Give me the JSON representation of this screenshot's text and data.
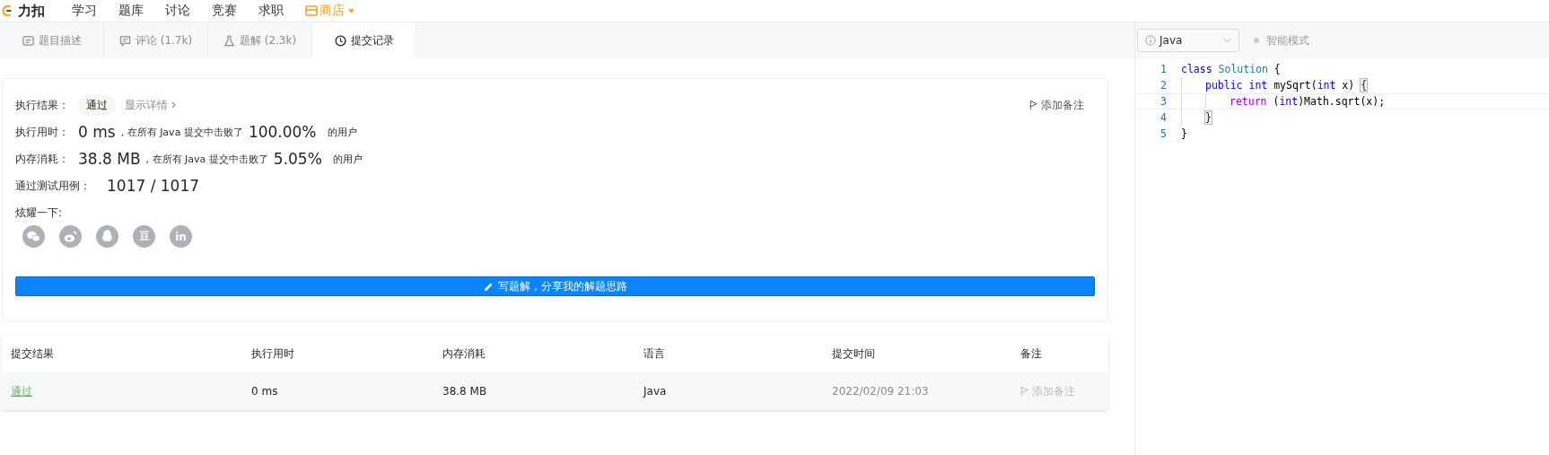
{
  "nav": {
    "logo": "力扣",
    "items": [
      {
        "label": "学习",
        "kind": "plain"
      },
      {
        "label": "题库",
        "kind": "plain"
      },
      {
        "label": "讨论",
        "kind": "plain"
      },
      {
        "label": "竞赛",
        "kind": "plain"
      },
      {
        "label": "求职",
        "kind": "plain"
      },
      {
        "label": "商店",
        "kind": "store"
      }
    ]
  },
  "tabs": [
    {
      "label": "题目描述",
      "selected": false
    },
    {
      "label": "评论 (1.7k)",
      "selected": false
    },
    {
      "label": "题解 (2.3k)",
      "selected": false
    },
    {
      "label": "提交记录",
      "selected": true
    }
  ],
  "result": {
    "label": "执行结果：",
    "status": "通过",
    "details_link": "显示详情",
    "add_note": "添加备注",
    "stats": [
      {
        "label": "执行用时：",
        "value": "0 ms",
        "mid": ", 在所有 Java 提交中击败了",
        "percent": "100.00%",
        "suffix": "的用户"
      },
      {
        "label": "内存消耗：",
        "value": "38.8 MB",
        "mid": ", 在所有 Java 提交中击败了",
        "percent": "5.05%",
        "suffix": "的用户"
      }
    ],
    "tests_label": "通过测试用例：",
    "tests": "1017 / 1017",
    "share_label": "炫耀一下:",
    "share": [
      {
        "kind": "wechat"
      },
      {
        "kind": "weibo"
      },
      {
        "kind": "qq"
      },
      {
        "kind": "text",
        "label": "豆"
      },
      {
        "kind": "text",
        "label": "in"
      }
    ],
    "write_button": "写题解，分享我的解题思路"
  },
  "table": {
    "columns": [
      "提交结果",
      "执行用时",
      "内存消耗",
      "语言",
      "提交时间",
      "备注"
    ],
    "rows": [
      {
        "result": "通过",
        "time": "0 ms",
        "memory": "38.8 MB",
        "language": "Java",
        "submitted": "2022/02/09 21:03",
        "note": "添加备注"
      }
    ]
  },
  "editor": {
    "language": "Java",
    "mode": "智能模式",
    "lines": [
      {
        "number": "1",
        "current": false,
        "tokens": [
          {
            "text": "class",
            "kind": "keyword"
          },
          {
            "text": " Solution",
            "kind": "type"
          },
          {
            "text": " {",
            "kind": "plain"
          }
        ],
        "children": [
          {
            "number": "2",
            "current": false,
            "tokens": [
              {
                "text": "public",
                "kind": "keyword"
              },
              {
                "text": " int",
                "kind": "keyword"
              },
              {
                "text": " mySqrt(",
                "kind": "plain"
              },
              {
                "text": "int",
                "kind": "keyword"
              },
              {
                "text": " x) ",
                "kind": "plain"
              },
              {
                "text": "{",
                "kind": "bracket"
              }
            ],
            "children": [
              {
                "number": "3",
                "current": true,
                "tokens": [
                  {
                    "text": "return",
                    "kind": "control"
                  },
                  {
                    "text": " (",
                    "kind": "plain"
                  },
                  {
                    "text": "int",
                    "kind": "keyword"
                  },
                  {
                    "text": ")Math.sqrt(x);",
                    "kind": "plain"
                  }
                ]
              }
            ]
          },
          {
            "number": "4",
            "current": false,
            "tokens": [
              {
                "text": "}",
                "kind": "bracket"
              }
            ]
          }
        ]
      },
      {
        "number": "5",
        "current": false,
        "tokens": [
          {
            "text": "}",
            "kind": "plain"
          }
        ]
      }
    ]
  }
}
